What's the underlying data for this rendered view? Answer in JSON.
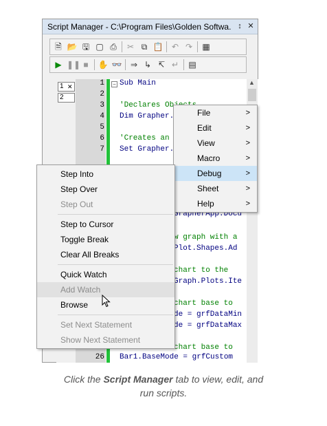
{
  "window": {
    "title": "Script Manager - C:\\Program Files\\Golden Softwa...",
    "pin_glyph": "↕",
    "close_glyph": "✕"
  },
  "toolbar1": [
    "new-file",
    "open-folder",
    "save",
    "save-all",
    "print",
    "cut",
    "copy",
    "paste",
    "undo",
    "redo",
    "dialog-editor"
  ],
  "toolbar2": [
    "run",
    "pause",
    "stop",
    "hand",
    "quick-watch",
    "step",
    "step-into",
    "step-over",
    "step-out",
    "object-browser"
  ],
  "gutter": {
    "box1": "1",
    "box2": "2"
  },
  "code_lines": [
    {
      "n": "1",
      "text": "Sub Main",
      "color": "#000080"
    },
    {
      "n": "2",
      "text": "",
      "color": "#000000"
    },
    {
      "n": "3",
      "text": "'Declares Objects",
      "color": "#008000"
    },
    {
      "n": "4",
      "text": "Dim Grapher.",
      "color": "#000080"
    },
    {
      "n": "5",
      "text": "",
      "color": "#000000"
    },
    {
      "n": "6",
      "text": "'Creates an",
      "color": "#008000"
    },
    {
      "n": "7",
      "text": "Set Grapher.",
      "color": "#000080"
    },
    {
      "n": "26",
      "text": "Bar1.BaseMode = grfCustom",
      "color": "#000080"
    }
  ],
  "code_fragments": [
    "GrapherApp.Docu",
    "w graph with a",
    "Plot.Shapes.Ad",
    "chart to the",
    "Graph.Plots.Ite",
    "chart base to",
    "de = grfDataMin",
    "de = grfDataMax",
    "chart base to"
  ],
  "main_menu": [
    {
      "label": "File",
      "arrow": ">",
      "highlight": false
    },
    {
      "label": "Edit",
      "arrow": ">",
      "highlight": false
    },
    {
      "label": "View",
      "arrow": ">",
      "highlight": false
    },
    {
      "label": "Macro",
      "arrow": ">",
      "highlight": false
    },
    {
      "label": "Debug",
      "arrow": ">",
      "highlight": true
    },
    {
      "label": "Sheet",
      "arrow": ">",
      "highlight": false
    },
    {
      "label": "Help",
      "arrow": ">",
      "highlight": false
    }
  ],
  "debug_menu": {
    "step_into": "Step Into",
    "step_over": "Step Over",
    "step_out": "Step Out",
    "step_to_cursor": "Step to Cursor",
    "toggle_break": "Toggle Break",
    "clear_all_breaks": "Clear All Breaks",
    "quick_watch": "Quick Watch",
    "add_watch": "Add Watch",
    "browse": "Browse",
    "set_next_statement": "Set Next Statement",
    "show_next_statement": "Show Next Statement"
  },
  "caption": {
    "pre": "Click the ",
    "bold": "Script Manager",
    "post1": " tab to view, edit, and",
    "post2": "run scripts."
  },
  "colors": {
    "highlight": "#cce4f7",
    "greenbar": "#22c23a",
    "titlebar": "#d9e4f1"
  }
}
